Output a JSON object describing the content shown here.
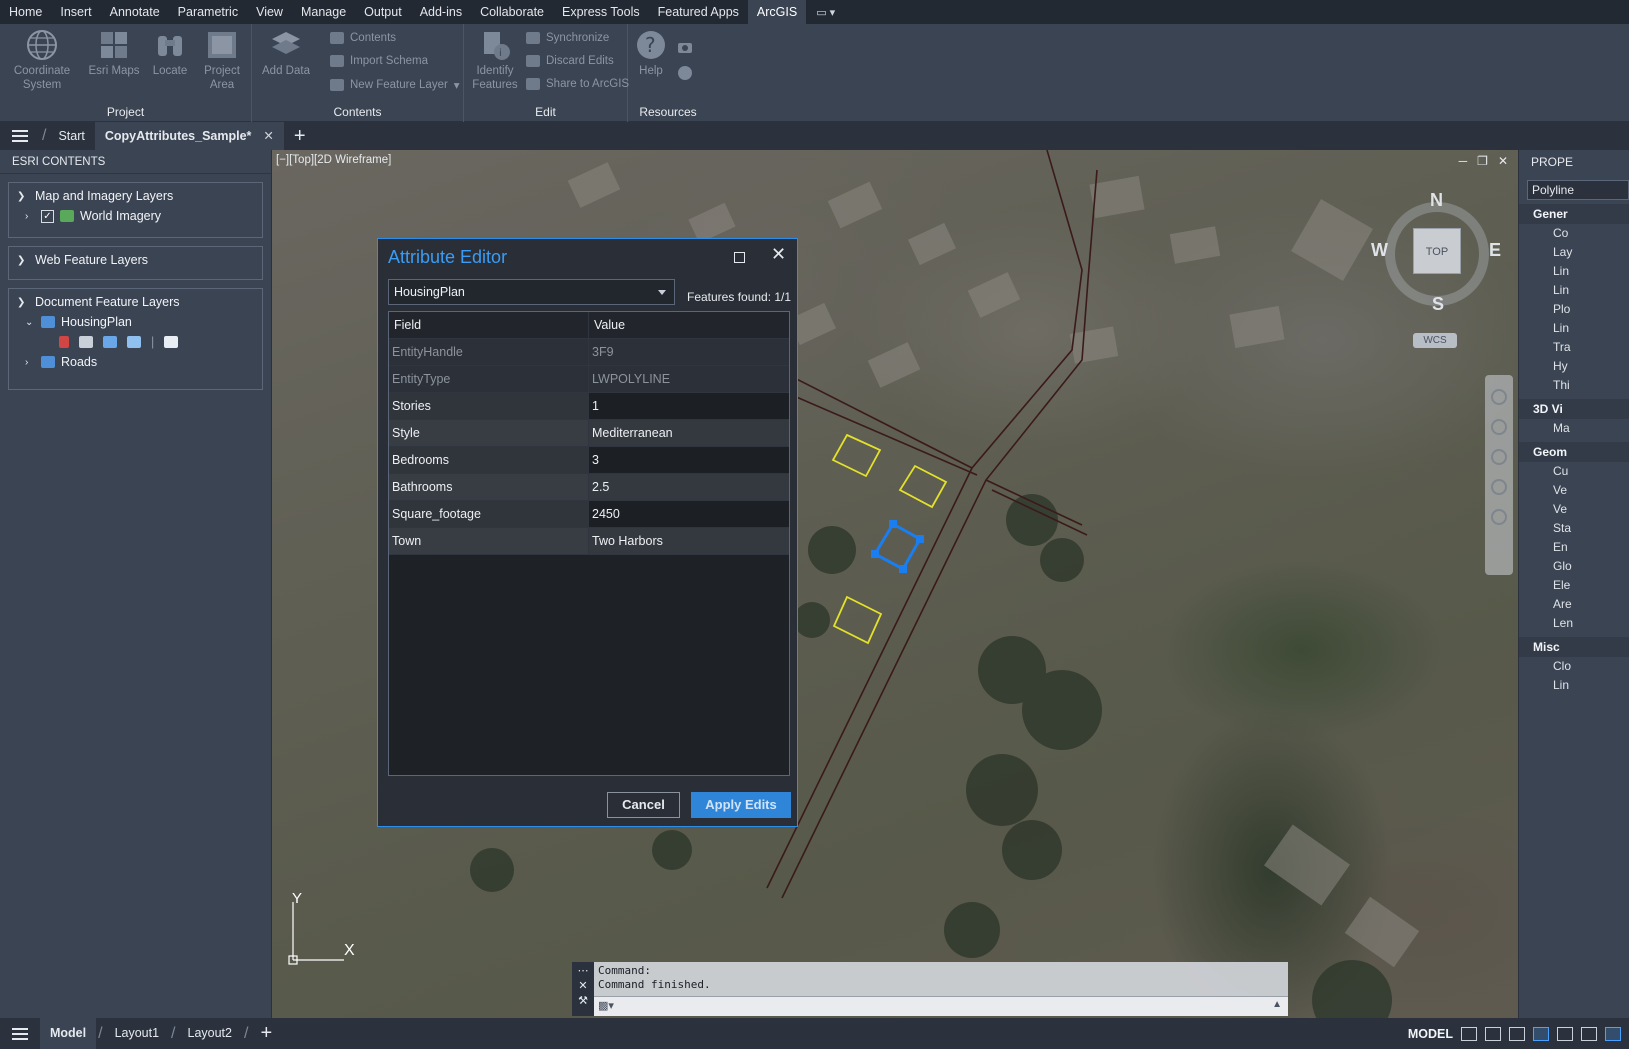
{
  "menu": {
    "items": [
      "Home",
      "Insert",
      "Annotate",
      "Parametric",
      "View",
      "Manage",
      "Output",
      "Add-ins",
      "Collaborate",
      "Express Tools",
      "Featured Apps",
      "ArcGIS"
    ],
    "active": "ArcGIS"
  },
  "ribbon": {
    "project": {
      "label": "Project",
      "coordinate_system": "Coordinate System",
      "esri_maps": "Esri Maps",
      "locate": "Locate",
      "project_area": "Project Area"
    },
    "contents": {
      "label": "Contents",
      "add_data": "Add Data",
      "contents": "Contents",
      "import_schema": "Import Schema",
      "new_feature_layer": "New Feature Layer"
    },
    "edit": {
      "label": "Edit",
      "identify_features": "Identify Features",
      "synchronize": "Synchronize",
      "discard_edits": "Discard Edits",
      "share_to_arcgis": "Share to ArcGIS"
    },
    "resources": {
      "label": "Resources",
      "help": "Help"
    }
  },
  "doc_tabs": {
    "start": "Start",
    "current": "CopyAttributes_Sample*"
  },
  "esri_contents": {
    "title": "ESRI CONTENTS",
    "map_imagery": {
      "title": "Map and Imagery Layers",
      "layer": "World Imagery"
    },
    "web_feature": {
      "title": "Web Feature Layers"
    },
    "document_feature": {
      "title": "Document Feature Layers",
      "housing": "HousingPlan",
      "roads": "Roads"
    }
  },
  "viewport": {
    "label": "[−][Top][2D Wireframe]",
    "viewcube": {
      "top": "TOP",
      "n": "N",
      "s": "S",
      "e": "E",
      "w": "W",
      "wcs": "WCS"
    },
    "ucs_x": "X",
    "ucs_y": "Y"
  },
  "command_line": {
    "line1": "Command:",
    "line2": "Command finished."
  },
  "properties": {
    "title": "PROPE",
    "selected": "Polyline",
    "cat_general": "Gener",
    "general_props": [
      "Co",
      "Lay",
      "Lin",
      "Lin",
      "Plo",
      "Lin",
      "Tra",
      "Hy",
      "Thi"
    ],
    "cat_3d": "3D Vi",
    "props_3d": [
      "Ma"
    ],
    "cat_geometry": "Geom",
    "geometry_props": [
      "Cu",
      "Ve",
      "Ve",
      "Sta",
      "En",
      "Glo",
      "Ele",
      "Are",
      "Len"
    ],
    "cat_misc": "Misc",
    "misc_props": [
      "Clo",
      "Lin"
    ]
  },
  "status": {
    "model_tab": "Model",
    "layout1": "Layout1",
    "layout2": "Layout2",
    "space": "MODEL"
  },
  "attribute_editor": {
    "title": "Attribute Editor",
    "layer": "HousingPlan",
    "features_found": "Features found: 1/1",
    "col_field": "Field",
    "col_value": "Value",
    "rows": [
      {
        "field": "EntityHandle",
        "value": "3F9",
        "readonly": true
      },
      {
        "field": "EntityType",
        "value": "LWPOLYLINE",
        "readonly": true
      },
      {
        "field": "Stories",
        "value": "1",
        "readonly": false
      },
      {
        "field": "Style",
        "value": "Mediterranean",
        "readonly": false
      },
      {
        "field": "Bedrooms",
        "value": "3",
        "readonly": false
      },
      {
        "field": "Bathrooms",
        "value": "2.5",
        "readonly": false
      },
      {
        "field": "Square_footage",
        "value": "2450",
        "readonly": false
      },
      {
        "field": "Town",
        "value": "Two Harbors",
        "readonly": false
      }
    ],
    "cancel": "Cancel",
    "apply": "Apply Edits"
  },
  "colors": {
    "accent": "#2c8ee8",
    "parcel_outline": "#e3e12a",
    "selected_parcel": "#1a7df0",
    "road_lines": "#3a1a1a"
  }
}
